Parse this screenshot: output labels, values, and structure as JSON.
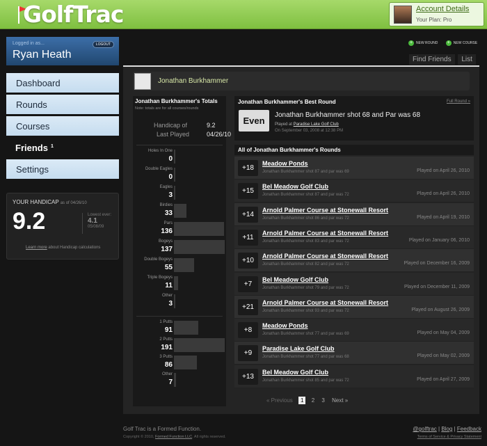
{
  "header": {
    "logo": "GolfTrac",
    "account_link": "Account Details",
    "plan": "Your Plan: Pro"
  },
  "sidebar": {
    "logged_in_label": "Logged in as...",
    "logout": "LOGOUT",
    "user": "Ryan Heath",
    "nav": [
      {
        "label": "Dashboard"
      },
      {
        "label": "Rounds"
      },
      {
        "label": "Courses"
      },
      {
        "label": "Friends",
        "badge": "1"
      },
      {
        "label": "Settings"
      }
    ],
    "handicap": {
      "title": "YOUR HANDICAP",
      "as_of": "as of 04/26/10",
      "value": "9.2",
      "lowest_label": "Lowest ever:",
      "lowest_value": "4.1",
      "lowest_date": "05/08/09",
      "learn_link": "Learn more",
      "learn_text": "about Handicap calculations"
    }
  },
  "actions": {
    "new_round": "NEW ROUND",
    "new_course": "NEW COURSE"
  },
  "tabs": {
    "find_friends": "Find Friends",
    "list": "List"
  },
  "profile": {
    "name": "Jonathan Burkhammer"
  },
  "totals": {
    "title": "Jonathan Burkhammer's Totals",
    "note": "Note: totals are for all courses/rounds",
    "handicap_label": "Handicap of",
    "handicap_value": "9.2",
    "last_played_label": "Last Played",
    "last_played_value": "04/26/10",
    "stats": [
      {
        "label": "Holes In One",
        "value": "0",
        "frac": 0
      },
      {
        "label": "Double Eagles",
        "value": "0",
        "frac": 0
      },
      {
        "label": "Eagles",
        "value": "3",
        "frac": 0.02
      },
      {
        "label": "Birdies",
        "value": "33",
        "frac": 0.24
      },
      {
        "label": "Pars",
        "value": "136",
        "frac": 0.99
      },
      {
        "label": "Bogeys",
        "value": "137",
        "frac": 1.0
      },
      {
        "label": "Double Bogeys",
        "value": "55",
        "frac": 0.4
      },
      {
        "label": "Triple Bogeys",
        "value": "11",
        "frac": 0.08
      },
      {
        "label": "Other",
        "value": "3",
        "frac": 0.02
      }
    ],
    "putts": [
      {
        "label": "1 Putts",
        "value": "91",
        "frac": 0.48
      },
      {
        "label": "2 Putts",
        "value": "191",
        "frac": 1.0
      },
      {
        "label": "3 Putts",
        "value": "86",
        "frac": 0.45
      },
      {
        "label": "Other",
        "value": "7",
        "frac": 0.04
      }
    ]
  },
  "best_round": {
    "title": "Jonathan Burkhammer's Best Round",
    "link": "Full Round »",
    "score": "Even",
    "text": "Jonathan Burkhammer shot 68 and Par was 68",
    "played_at": "Played at",
    "course": "Paradise Lake Golf Club",
    "date": "On September 03, 2008 at 12:38 PM"
  },
  "rounds": {
    "title": "All of Jonathan Burkhammer's Rounds",
    "items": [
      {
        "score": "+18",
        "course": "Meadow Ponds",
        "desc": "Jonathan Burkhammer shot 87 and par was 69",
        "date": "Played on April 26, 2010"
      },
      {
        "score": "+15",
        "course": "Bel Meadow Golf Club",
        "desc": "Jonathan Burkhammer shot 87 and par was 72",
        "date": "Played on April 26, 2010"
      },
      {
        "score": "+14",
        "course": "Arnold Palmer Course at Stonewall Resort",
        "desc": "Jonathan Burkhammer shot 86 and par was 72",
        "date": "Played on April 19, 2010"
      },
      {
        "score": "+11",
        "course": "Arnold Palmer Course at Stonewall Resort",
        "desc": "Jonathan Burkhammer shot 83 and par was 72",
        "date": "Played on January 06, 2010"
      },
      {
        "score": "+10",
        "course": "Arnold Palmer Course at Stonewall Resort",
        "desc": "Jonathan Burkhammer shot 82 and par was 72",
        "date": "Played on December 16, 2009"
      },
      {
        "score": "+7",
        "course": "Bel Meadow Golf Club",
        "desc": "Jonathan Burkhammer shot 79 and par was 72",
        "date": "Played on December 11, 2009"
      },
      {
        "score": "+21",
        "course": "Arnold Palmer Course at Stonewall Resort",
        "desc": "Jonathan Burkhammer shot 93 and par was 72",
        "date": "Played on August 26, 2009"
      },
      {
        "score": "+8",
        "course": "Meadow Ponds",
        "desc": "Jonathan Burkhammer shot 77 and par was 69",
        "date": "Played on May 04, 2009"
      },
      {
        "score": "+9",
        "course": "Paradise Lake Golf Club",
        "desc": "Jonathan Burkhammer shot 77 and par was 68",
        "date": "Played on May 02, 2009"
      },
      {
        "score": "+13",
        "course": "Bel Meadow Golf Club",
        "desc": "Jonathan Burkhammer shot 85 and par was 72",
        "date": "Played on April 27, 2009"
      }
    ]
  },
  "pager": {
    "previous": "« Previous",
    "pages": [
      "1",
      "2",
      "3"
    ],
    "next": "Next »"
  },
  "footer": {
    "brand": "Golf Trac is a Formed Function.",
    "copyright": "Copyright © 2010,",
    "company": "Formed Function LLC",
    "rights": ". All rights reserved.",
    "links": [
      "@golftrac",
      "Blog",
      "Feedback"
    ],
    "legal": "Terms of Service & Privacy Statement"
  }
}
